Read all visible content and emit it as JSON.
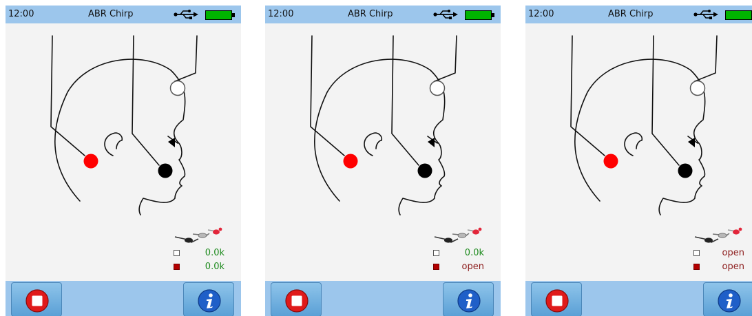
{
  "screens": [
    {
      "status": {
        "time": "12:00",
        "title": "ABR Chirp"
      },
      "impedance": [
        {
          "swatch": "white",
          "value": "0.0k",
          "state": "ok"
        },
        {
          "swatch": "red",
          "value": "0.0k",
          "state": "ok"
        }
      ]
    },
    {
      "status": {
        "time": "12:00",
        "title": "ABR Chirp"
      },
      "impedance": [
        {
          "swatch": "white",
          "value": "0.0k",
          "state": "ok"
        },
        {
          "swatch": "red",
          "value": "open",
          "state": "bad"
        }
      ]
    },
    {
      "status": {
        "time": "12:00",
        "title": "ABR Chirp"
      },
      "impedance": [
        {
          "swatch": "white",
          "value": "open",
          "state": "bad"
        },
        {
          "swatch": "red",
          "value": "open",
          "state": "bad"
        }
      ]
    }
  ],
  "icons": {
    "status": [
      "usb-icon",
      "battery-icon"
    ],
    "diagram": [
      "electrode-cable-icon"
    ],
    "buttons": [
      "stop-icon",
      "info-icon"
    ]
  },
  "colors": {
    "bar_blue": "#9cc6ec",
    "screen_bg": "#f3f3f3",
    "electrode_red": "#ff0000",
    "electrode_black": "#000000",
    "battery_green": "#00b400",
    "value_ok": "#1d8a1d",
    "value_open": "#8b1a1a",
    "stop_red": "#e01a1a",
    "info_blue": "#1f5fc8"
  }
}
